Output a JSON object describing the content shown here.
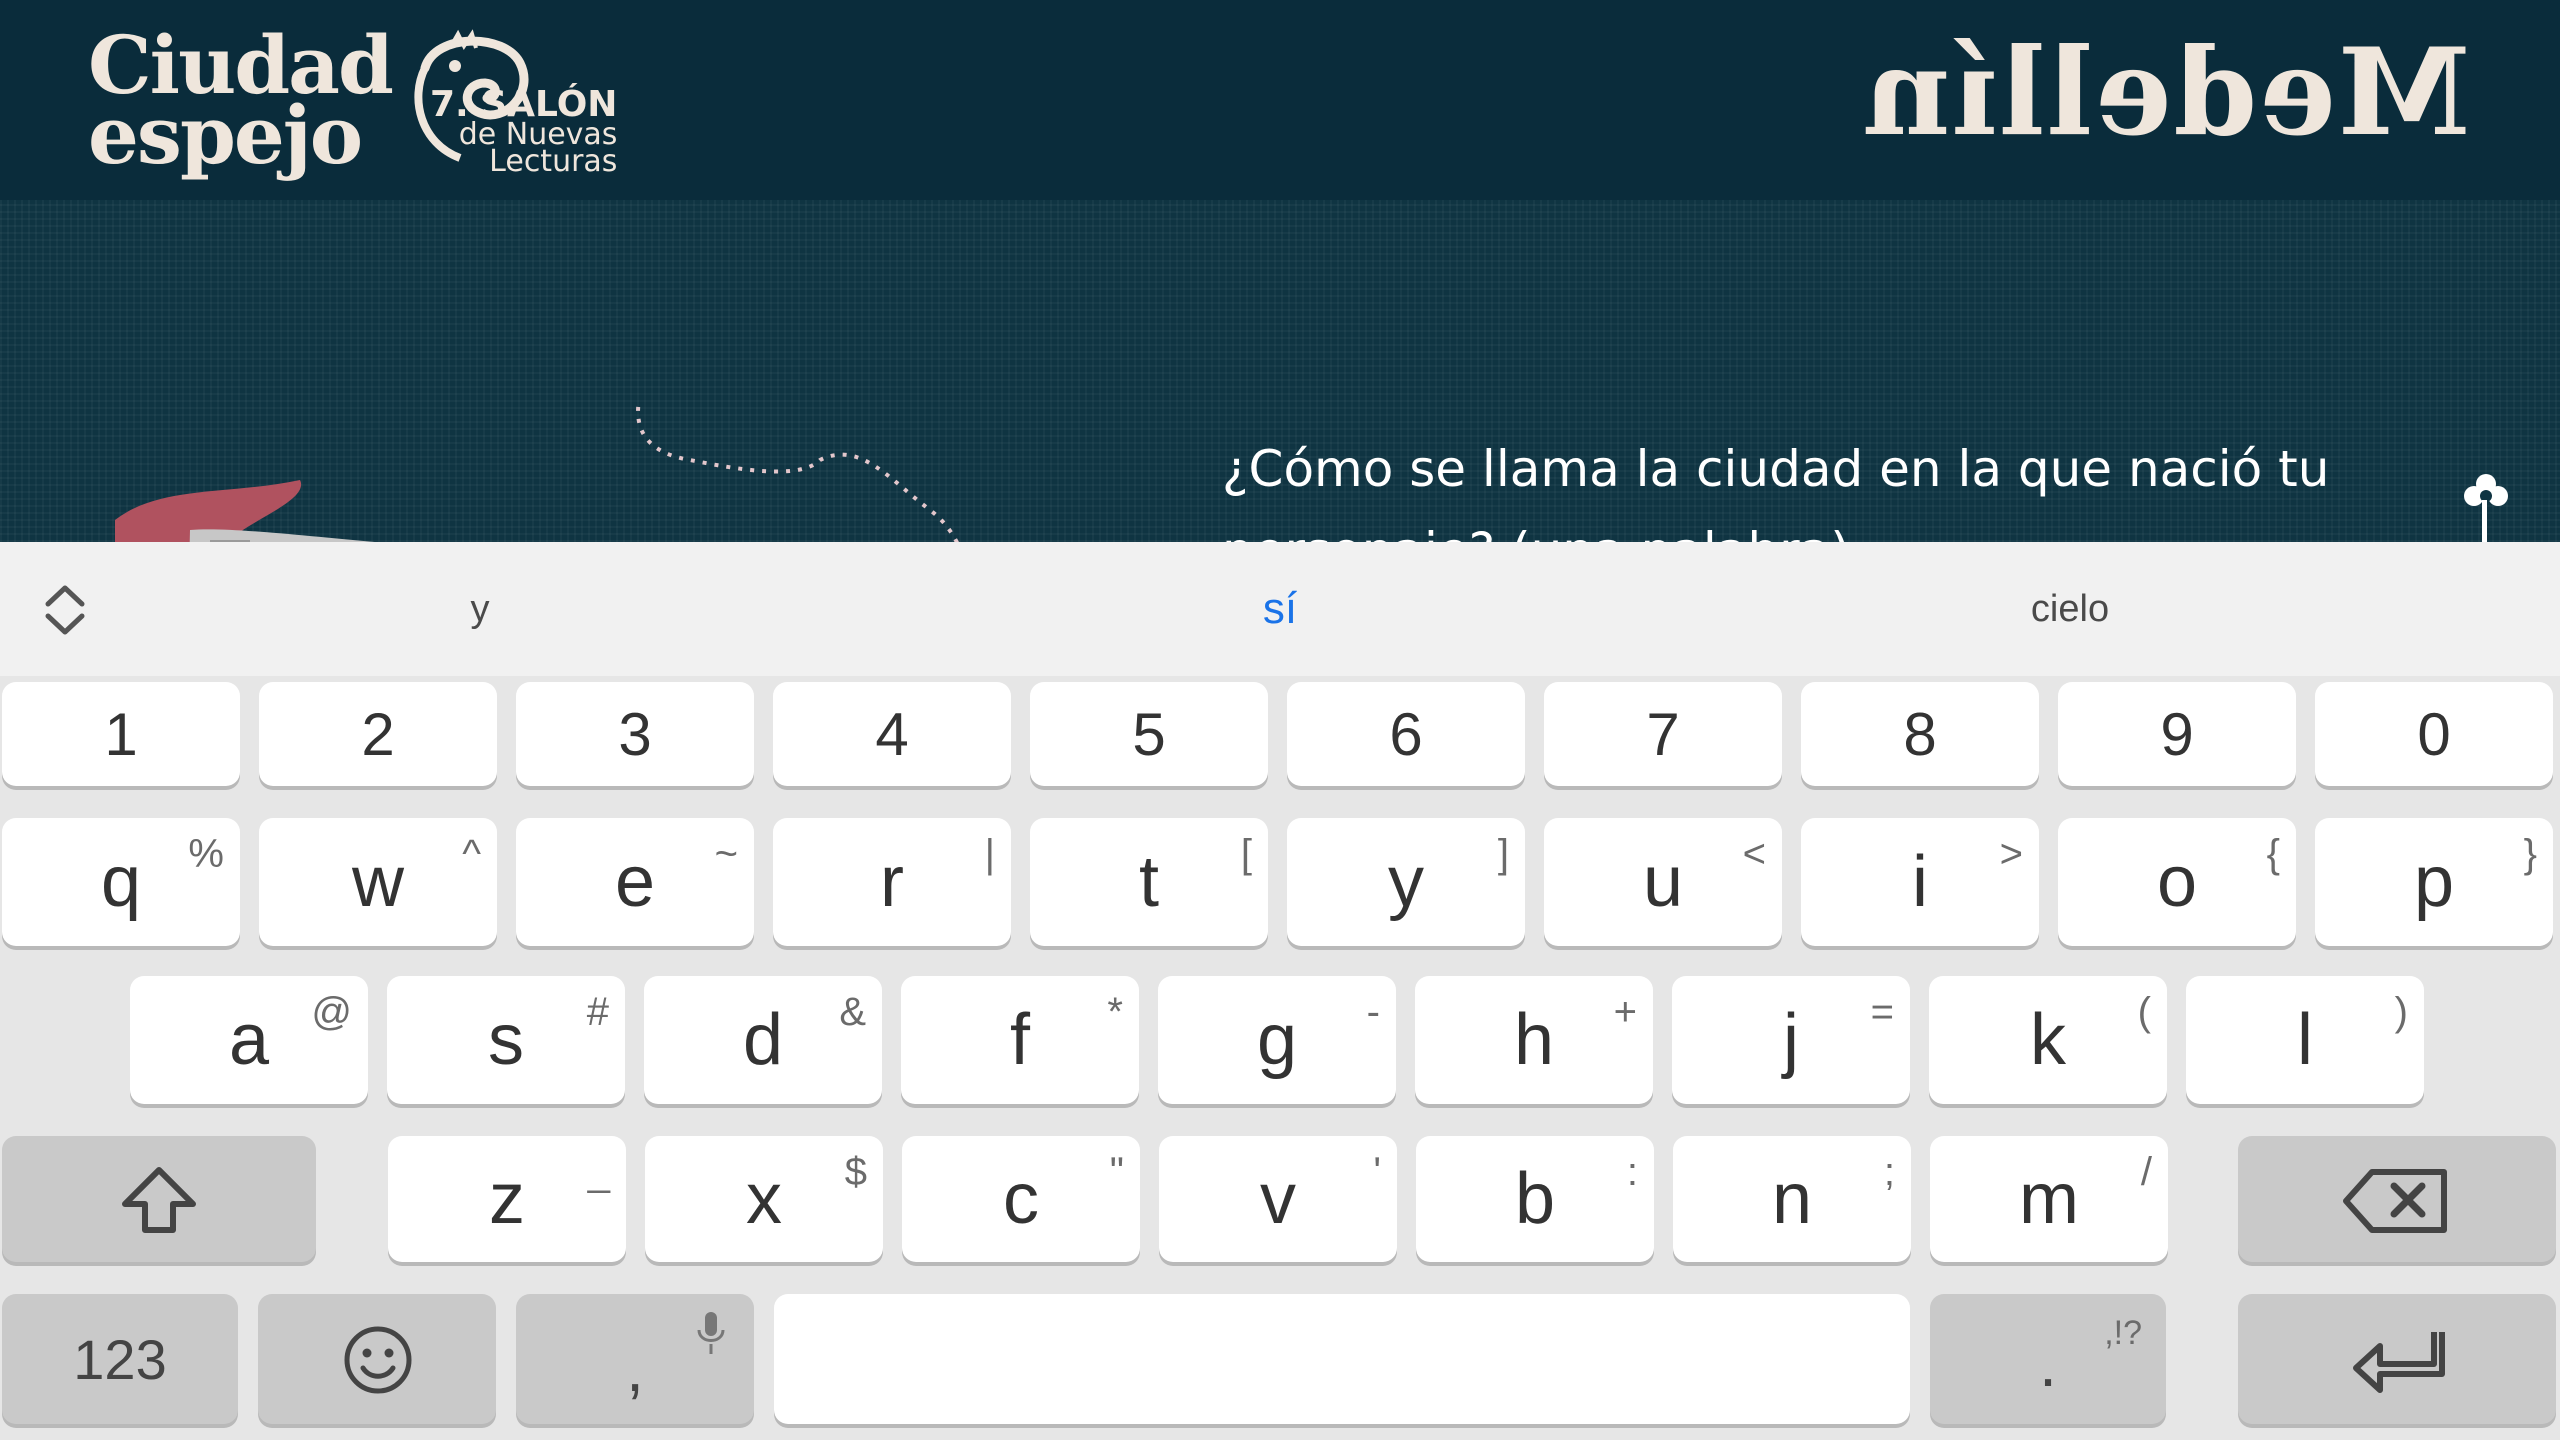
{
  "header": {
    "brand_line1": "Ciudad",
    "brand_line2": "espejo",
    "salon_line1": "7. SALÓN",
    "salon_line2": "de Nuevas",
    "salon_line3": "Lecturas",
    "city": "Medellín"
  },
  "question": {
    "text": "¿Cómo se llama la ciudad en la que nació tu personaje? (una palabra)",
    "answer_value": ""
  },
  "suggestions": {
    "left": "y",
    "middle": "sí",
    "right": "cielo"
  },
  "keyboard": {
    "numbers": [
      "1",
      "2",
      "3",
      "4",
      "5",
      "6",
      "7",
      "8",
      "9",
      "0"
    ],
    "row1": [
      {
        "k": "q",
        "a": "%"
      },
      {
        "k": "w",
        "a": "^"
      },
      {
        "k": "e",
        "a": "~"
      },
      {
        "k": "r",
        "a": "|"
      },
      {
        "k": "t",
        "a": "["
      },
      {
        "k": "y",
        "a": "]"
      },
      {
        "k": "u",
        "a": "<"
      },
      {
        "k": "i",
        "a": ">"
      },
      {
        "k": "o",
        "a": "{"
      },
      {
        "k": "p",
        "a": "}"
      }
    ],
    "row2": [
      {
        "k": "a",
        "a": "@"
      },
      {
        "k": "s",
        "a": "#"
      },
      {
        "k": "d",
        "a": "&"
      },
      {
        "k": "f",
        "a": "*"
      },
      {
        "k": "g",
        "a": "-"
      },
      {
        "k": "h",
        "a": "+"
      },
      {
        "k": "j",
        "a": "="
      },
      {
        "k": "k",
        "a": "("
      },
      {
        "k": "l",
        "a": ")"
      }
    ],
    "row3": [
      {
        "k": "z",
        "a": "_"
      },
      {
        "k": "x",
        "a": "$"
      },
      {
        "k": "c",
        "a": "\""
      },
      {
        "k": "v",
        "a": "'"
      },
      {
        "k": "b",
        "a": ":"
      },
      {
        "k": "n",
        "a": ";"
      },
      {
        "k": "m",
        "a": "/"
      }
    ],
    "symbols_label": "123",
    "comma": ",",
    "period": ".",
    "period_alt": ",!?"
  },
  "colors": {
    "app_bg": "#0b2e3c",
    "accent": "#b24a5f",
    "cream": "#efe6dc",
    "suggest_active": "#1a73e8"
  },
  "icons": [
    "keyboard-toggle-icon",
    "shift-icon",
    "backspace-icon",
    "emoji-icon",
    "mic-icon",
    "enter-icon",
    "flower-icon"
  ]
}
